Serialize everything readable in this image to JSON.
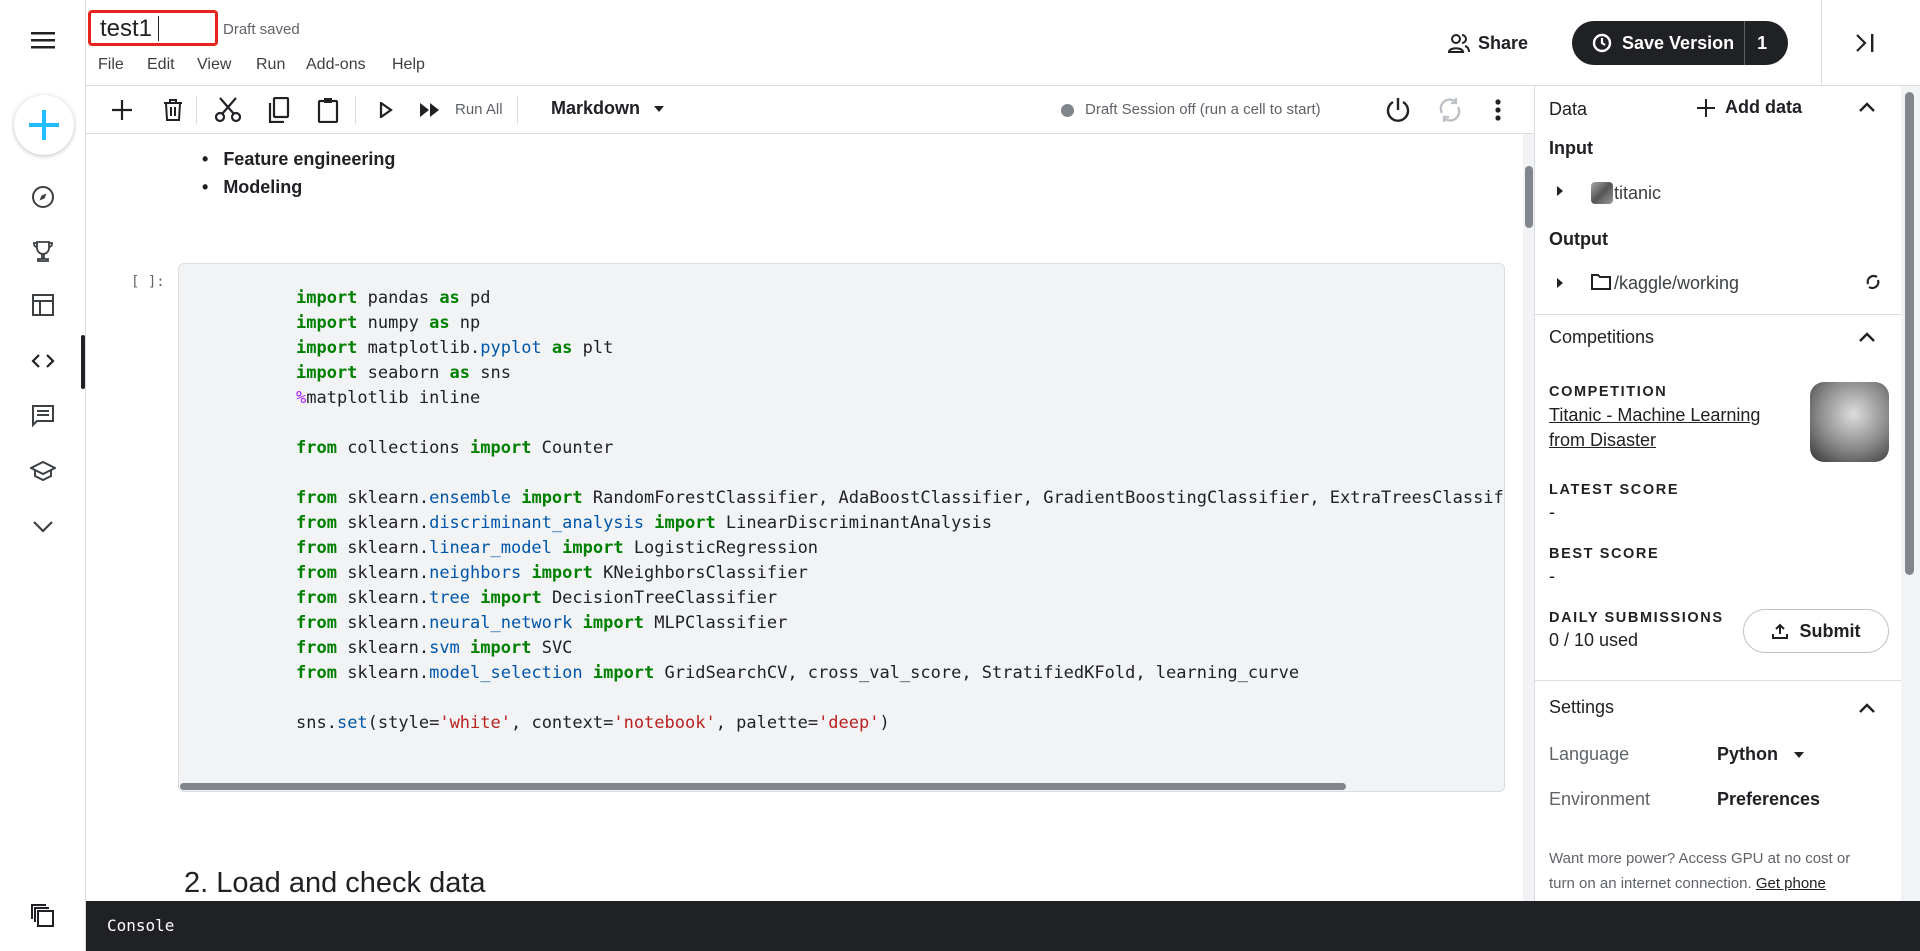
{
  "header": {
    "title": "test1",
    "status": "Draft saved",
    "menu": [
      "File",
      "Edit",
      "View",
      "Run",
      "Add-ons",
      "Help"
    ],
    "share_label": "Share",
    "save_version_label": "Save Version",
    "save_version_count": "1"
  },
  "toolbar": {
    "run_all_label": "Run All",
    "cell_type": "Markdown",
    "session_status": "Draft Session off (run a cell to start)"
  },
  "notebook": {
    "bullets": [
      "Feature engineering",
      "Modeling"
    ],
    "cell_prompt": "[ ]:",
    "code_lines": [
      [
        [
          "import",
          "kw"
        ],
        [
          " pandas ",
          ""
        ],
        [
          "as",
          "kw"
        ],
        [
          " pd",
          ""
        ]
      ],
      [
        [
          "import",
          "kw"
        ],
        [
          " numpy ",
          ""
        ],
        [
          "as",
          "kw"
        ],
        [
          " np",
          ""
        ]
      ],
      [
        [
          "import",
          "kw"
        ],
        [
          " matplotlib.",
          ""
        ],
        [
          "pyplot",
          "mod"
        ],
        [
          " ",
          ""
        ],
        [
          "as",
          "kw"
        ],
        [
          " plt",
          ""
        ]
      ],
      [
        [
          "import",
          "kw"
        ],
        [
          " seaborn ",
          ""
        ],
        [
          "as",
          "kw"
        ],
        [
          " sns",
          ""
        ]
      ],
      [
        [
          "%",
          "mag"
        ],
        [
          "matplotlib inline",
          ""
        ]
      ],
      [],
      [
        [
          "from",
          "kw"
        ],
        [
          " collections ",
          ""
        ],
        [
          "import",
          "kw"
        ],
        [
          " Counter",
          ""
        ]
      ],
      [],
      [
        [
          "from",
          "kw"
        ],
        [
          " sklearn.",
          ""
        ],
        [
          "ensemble",
          "mod"
        ],
        [
          " ",
          ""
        ],
        [
          "import",
          "kw"
        ],
        [
          " RandomForestClassifier, AdaBoostClassifier, GradientBoostingClassifier, ExtraTreesClassifier, V",
          ""
        ]
      ],
      [
        [
          "from",
          "kw"
        ],
        [
          " sklearn.",
          ""
        ],
        [
          "discriminant_analysis",
          "mod"
        ],
        [
          " ",
          ""
        ],
        [
          "import",
          "kw"
        ],
        [
          " LinearDiscriminantAnalysis",
          ""
        ]
      ],
      [
        [
          "from",
          "kw"
        ],
        [
          " sklearn.",
          ""
        ],
        [
          "linear_model",
          "mod"
        ],
        [
          " ",
          ""
        ],
        [
          "import",
          "kw"
        ],
        [
          " LogisticRegression",
          ""
        ]
      ],
      [
        [
          "from",
          "kw"
        ],
        [
          " sklearn.",
          ""
        ],
        [
          "neighbors",
          "mod"
        ],
        [
          " ",
          ""
        ],
        [
          "import",
          "kw"
        ],
        [
          " KNeighborsClassifier",
          ""
        ]
      ],
      [
        [
          "from",
          "kw"
        ],
        [
          " sklearn.",
          ""
        ],
        [
          "tree",
          "mod"
        ],
        [
          " ",
          ""
        ],
        [
          "import",
          "kw"
        ],
        [
          " DecisionTreeClassifier",
          ""
        ]
      ],
      [
        [
          "from",
          "kw"
        ],
        [
          " sklearn.",
          ""
        ],
        [
          "neural_network",
          "mod"
        ],
        [
          " ",
          ""
        ],
        [
          "import",
          "kw"
        ],
        [
          " MLPClassifier",
          ""
        ]
      ],
      [
        [
          "from",
          "kw"
        ],
        [
          " sklearn.",
          ""
        ],
        [
          "svm",
          "mod"
        ],
        [
          " ",
          ""
        ],
        [
          "import",
          "kw"
        ],
        [
          " SVC",
          ""
        ]
      ],
      [
        [
          "from",
          "kw"
        ],
        [
          " sklearn.",
          ""
        ],
        [
          "model_selection",
          "mod"
        ],
        [
          " ",
          ""
        ],
        [
          "import",
          "kw"
        ],
        [
          " GridSearchCV, cross_val_score, StratifiedKFold, learning_curve",
          ""
        ]
      ],
      [],
      [
        [
          "sns.",
          ""
        ],
        [
          "set",
          "mod"
        ],
        [
          "(style=",
          ""
        ],
        [
          "'white'",
          "str"
        ],
        [
          ", context=",
          ""
        ],
        [
          "'notebook'",
          "str"
        ],
        [
          ", palette=",
          ""
        ],
        [
          "'deep'",
          "str"
        ],
        [
          ")",
          ""
        ]
      ]
    ],
    "next_heading": "2. Load and check data"
  },
  "right_panel": {
    "data_title": "Data",
    "add_data_label": "Add data",
    "input_label": "Input",
    "input_item": "titanic",
    "output_label": "Output",
    "output_item": "/kaggle/working",
    "competitions_title": "Competitions",
    "competition_caption": "COMPETITION",
    "competition_name_1": "Titanic - Machine Learning",
    "competition_name_2": "from Disaster",
    "latest_score_caption": "LATEST SCORE",
    "latest_score": "-",
    "best_score_caption": "BEST SCORE",
    "best_score": "-",
    "daily_caption": "DAILY SUBMISSIONS",
    "daily_value": "0 / 10 used",
    "submit_label": "Submit",
    "settings_title": "Settings",
    "language_label": "Language",
    "language_value": "Python",
    "environment_label": "Environment",
    "environment_value": "Preferences",
    "power_text_1": "Want more power? Access GPU at no cost or",
    "power_text_2": "turn on an internet connection.",
    "power_link": "Get phone"
  },
  "console": {
    "label": "Console"
  },
  "colors": {
    "accent": "#20beff",
    "dark": "#202124",
    "highlight_box": "#e8231d"
  }
}
